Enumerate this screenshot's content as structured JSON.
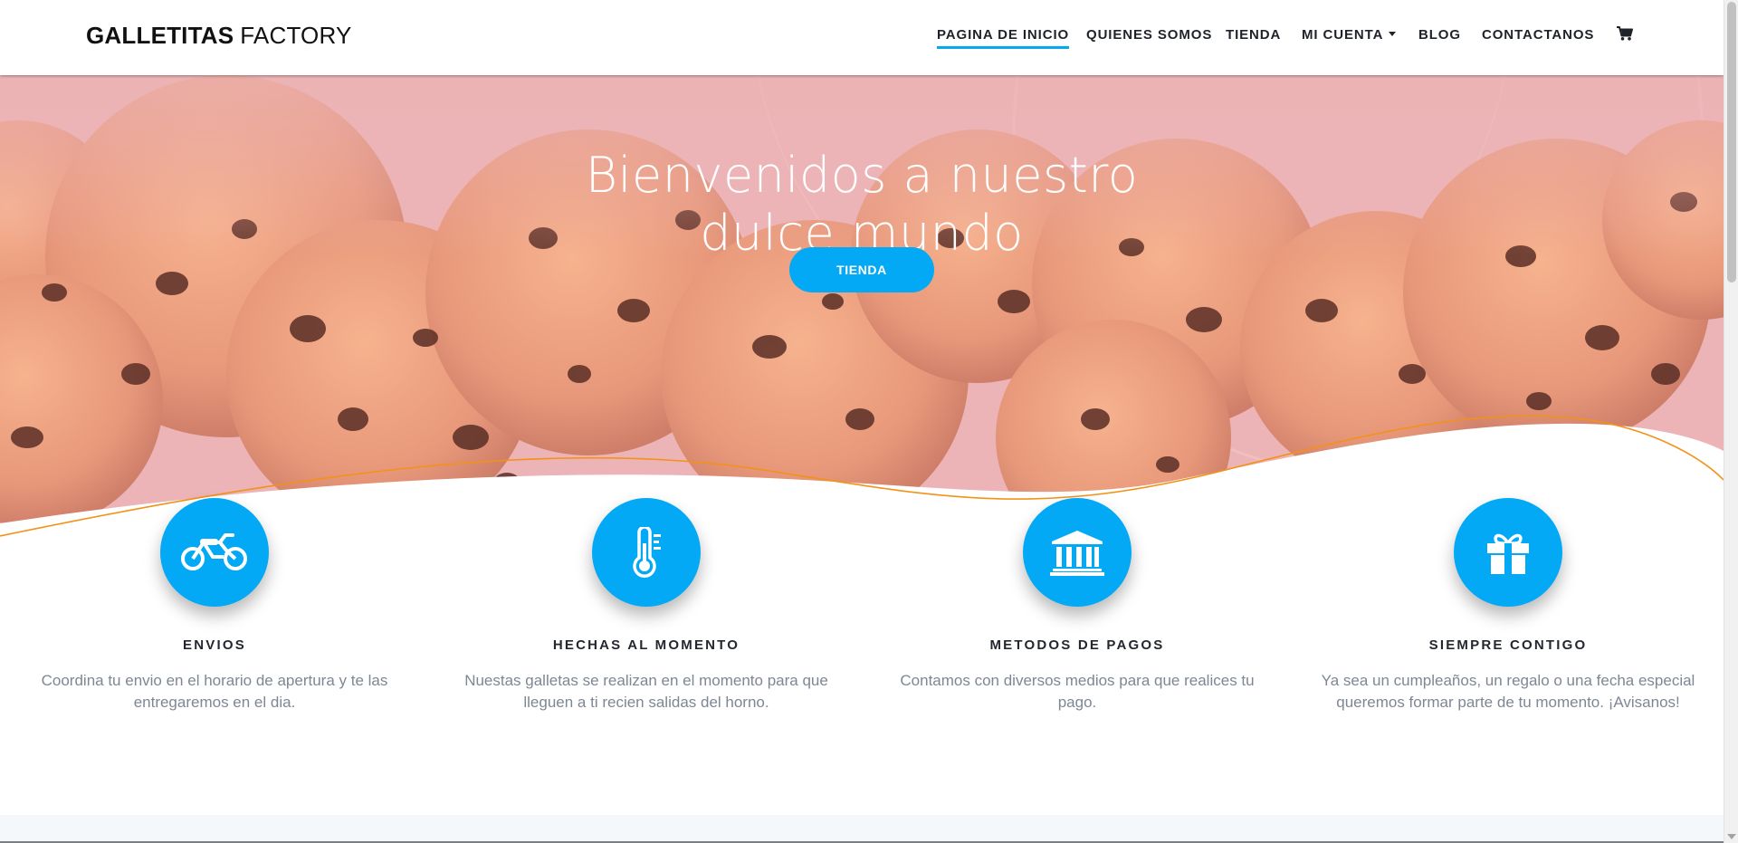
{
  "header": {
    "brand_bold": "GALLETITAS",
    "brand_light": "FACTORY",
    "nav": [
      {
        "label": "PAGINA DE INICIO",
        "active": true
      },
      {
        "label": "QUIENES SOMOS"
      },
      {
        "label": "TIENDA"
      },
      {
        "label": "MI CUENTA",
        "dropdown": true
      },
      {
        "label": "BLOG"
      },
      {
        "label": "CONTACTANOS"
      }
    ],
    "cart_icon": "shopping-cart-icon"
  },
  "hero": {
    "title_line1": "Bienvenidos a nuestro",
    "title_line2": "dulce mundo",
    "button_label": "TIENDA"
  },
  "features": [
    {
      "icon": "motorcycle-icon",
      "title": "ENVIOS",
      "text": "Coordina tu envio en el horario de apertura y te las entregaremos en el dia."
    },
    {
      "icon": "thermometer-icon",
      "title": "HECHAS AL MOMENTO",
      "text": "Nuestas galletas se realizan en el momento para que lleguen a ti recien salidas del horno."
    },
    {
      "icon": "bank-icon",
      "title": "METODOS DE PAGOS",
      "text": "Contamos con diversos medios para que realices tu pago."
    },
    {
      "icon": "gift-icon",
      "title": "SIEMPRE CONTIGO",
      "text": "Ya sea un cumpleaños, un regalo o una fecha especial queremos formar parte de tu momento. ¡Avisanos!"
    }
  ],
  "colors": {
    "accent": "#03a9f4",
    "hero_overlay": "#e8a6ab",
    "wave_line": "#f29219"
  }
}
